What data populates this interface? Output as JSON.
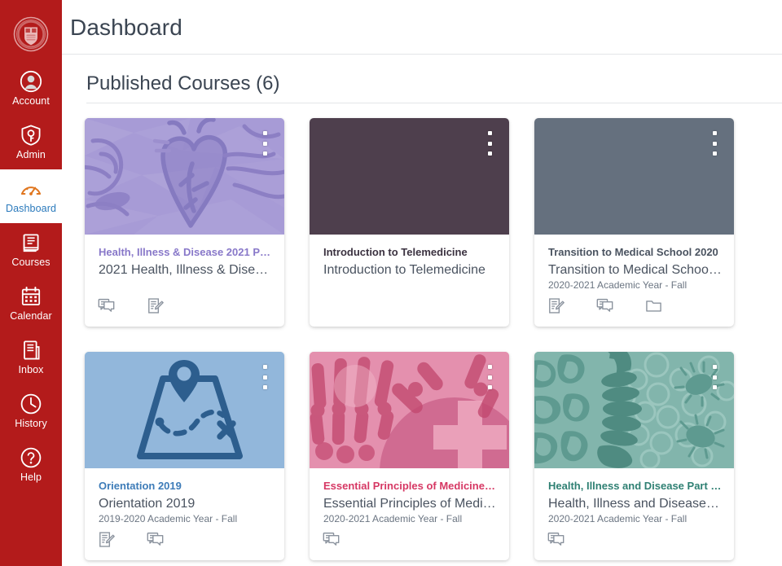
{
  "colors": {
    "sidebar_bg": "#B31B1B",
    "active_text": "#2B7ABC",
    "active_icon": "#E0761F",
    "heading_text": "#3B4552",
    "card_purple": "#A79BD6",
    "card_plum": "#4E3F4D",
    "card_slate": "#65707E",
    "card_blue": "#92B7DB",
    "card_pink": "#E490AE",
    "card_teal": "#82B5AC"
  },
  "sidebar": {
    "logo_name": "cornell-seal-logo",
    "items": [
      {
        "label": "Account",
        "icon": "account-icon",
        "active": false
      },
      {
        "label": "Admin",
        "icon": "shield-icon",
        "active": false
      },
      {
        "label": "Dashboard",
        "icon": "gauge-icon",
        "active": true
      },
      {
        "label": "Courses",
        "icon": "book-icon",
        "active": false
      },
      {
        "label": "Calendar",
        "icon": "calendar-icon",
        "active": false
      },
      {
        "label": "Inbox",
        "icon": "inbox-icon",
        "active": false
      },
      {
        "label": "History",
        "icon": "clock-icon",
        "active": false
      },
      {
        "label": "Help",
        "icon": "question-icon",
        "active": false
      }
    ]
  },
  "header": {
    "title": "Dashboard"
  },
  "section": {
    "title": "Published Courses (6)"
  },
  "cards": [
    {
      "link_text": "Health, Illness & Disease 2021 Par...",
      "subtitle": "2021 Health, Illness & Disease...",
      "term": "",
      "header_art": "anatomy-organs",
      "header_color": "#A79BD6",
      "link_color": "#8878C9",
      "kebab_label": "card-options-menu",
      "footer": [
        {
          "icon": "discussions-icon",
          "label": "Discussions"
        },
        {
          "icon": "assignments-icon",
          "label": "Assignments"
        }
      ]
    },
    {
      "link_text": "Introduction to Telemedicine",
      "subtitle": "Introduction to Telemedicine",
      "term": "",
      "header_art": "solid",
      "header_color": "#4E3F4D",
      "link_color": "#3B3240",
      "kebab_label": "card-options-menu",
      "footer": []
    },
    {
      "link_text": "Transition to Medical School 2020",
      "subtitle": "Transition to Medical School 2...",
      "term": "2020-2021 Academic Year - Fall",
      "header_art": "solid",
      "header_color": "#65707E",
      "link_color": "#4A5360",
      "kebab_label": "card-options-menu",
      "footer": [
        {
          "icon": "assignments-icon",
          "label": "Assignments"
        },
        {
          "icon": "discussions-icon",
          "label": "Discussions"
        },
        {
          "icon": "files-icon",
          "label": "Files"
        }
      ]
    },
    {
      "link_text": "Orientation 2019",
      "subtitle": "Orientation 2019",
      "term": "2019-2020 Academic Year - Fall",
      "header_art": "treasure-map",
      "header_color": "#92B7DB",
      "link_color": "#3E7CB8",
      "kebab_label": "card-options-menu",
      "footer": [
        {
          "icon": "assignments-icon",
          "label": "Assignments"
        },
        {
          "icon": "discussions-icon",
          "label": "Discussions"
        }
      ]
    },
    {
      "link_text": "Essential Principles of Medicine, 2...",
      "subtitle": "Essential Principles of Medicine",
      "term": "2020-2021 Academic Year - Fall",
      "header_art": "xray-hand",
      "header_color": "#E490AE",
      "link_color": "#D63864",
      "kebab_label": "card-options-menu",
      "footer": [
        {
          "icon": "discussions-icon",
          "label": "Discussions"
        }
      ]
    },
    {
      "link_text": "Health, Illness and Disease Part II, ...",
      "subtitle": "Health, Illness and Disease Par...",
      "term": "2020-2021 Academic Year - Fall",
      "header_art": "neuro-microbes",
      "header_color": "#82B5AC",
      "link_color": "#2F8073",
      "kebab_label": "card-options-menu",
      "footer": [
        {
          "icon": "discussions-icon",
          "label": "Discussions"
        }
      ]
    }
  ]
}
